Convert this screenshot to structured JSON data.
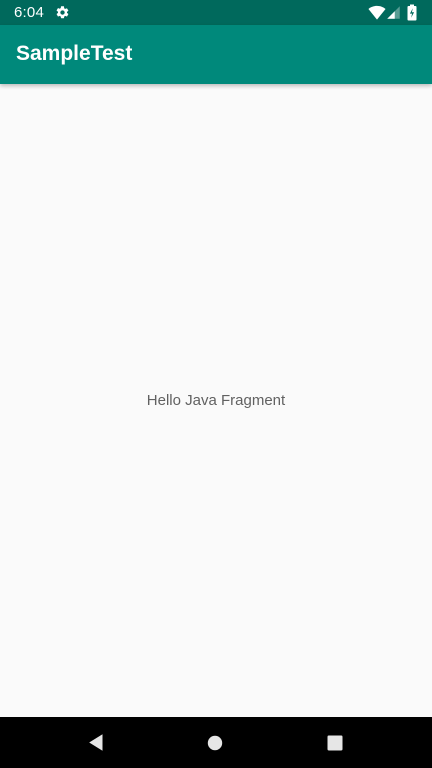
{
  "status_bar": {
    "time": "6:04",
    "background_color": "#00695c",
    "icons": [
      "settings-icon",
      "wifi-icon",
      "cell-signal-icon",
      "battery-charging-icon"
    ]
  },
  "app_bar": {
    "title": "SampleTest",
    "background_color": "#00897b"
  },
  "main": {
    "message": "Hello Java Fragment"
  },
  "nav_bar": {
    "buttons": [
      "back-icon",
      "home-icon",
      "recent-apps-icon"
    ]
  }
}
